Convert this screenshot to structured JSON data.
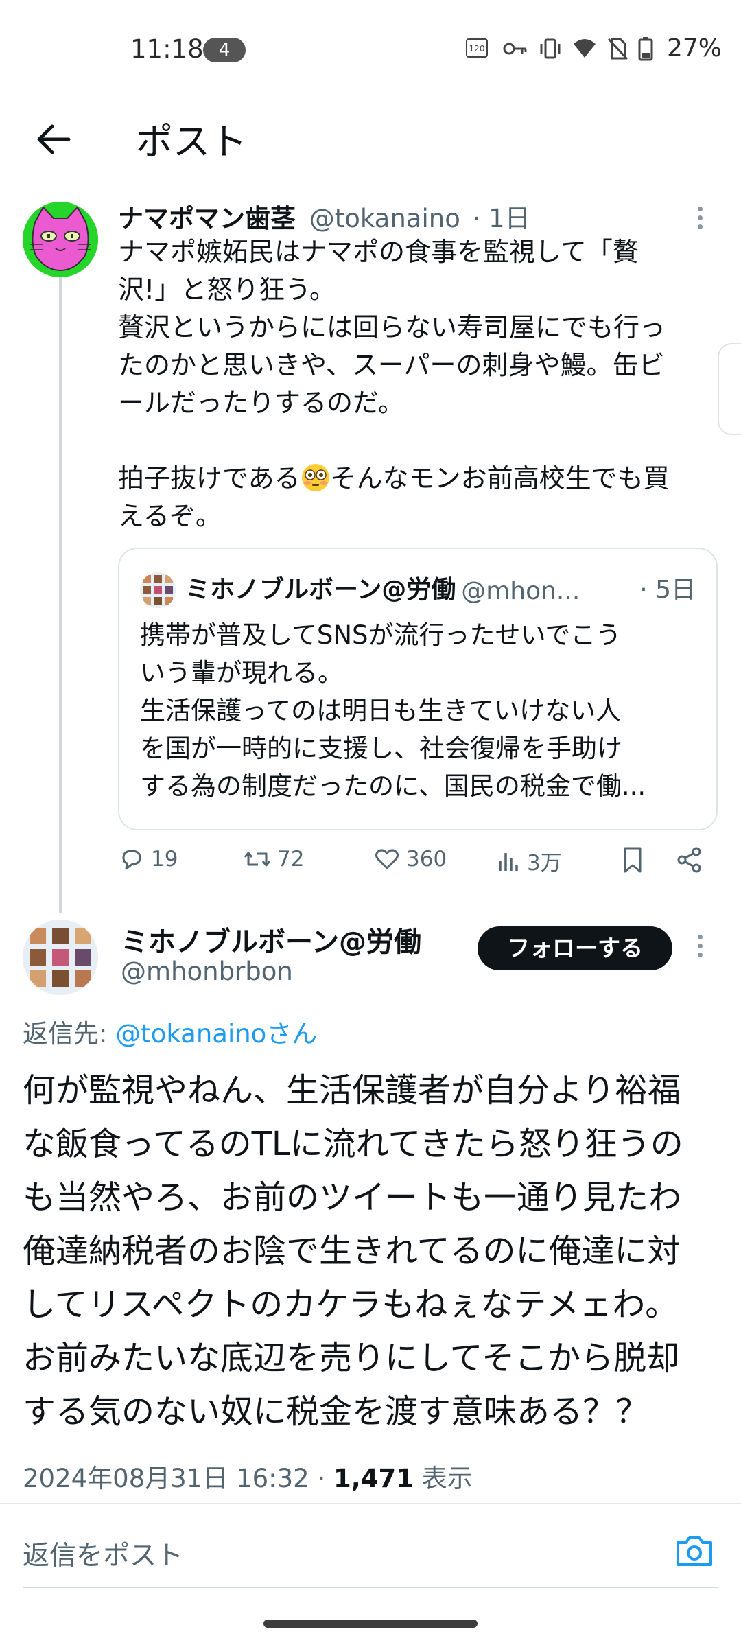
{
  "status_bar": {
    "time": "11:18",
    "notification_count": "4",
    "refresh_rate": "120",
    "battery": "27%"
  },
  "header": {
    "title": "ポスト"
  },
  "post1": {
    "author_name": "ナマポマン歯茎",
    "handle": "@tokanaino",
    "time": "· 1日",
    "text_before_emoji": "ナマポ嫉妬民はナマポの食事を監視して「贅\n沢!」と怒り狂う。\n贅沢というからには回らない寿司屋にでも行っ\nたのかと思いきや、スーパーの刺身や鰻。缶ビ\nールだったりするのだ。\n\n拍子抜けである",
    "emoji": "flushed-face-emoji",
    "text_after_emoji": "そんなモンお前高校生でも買\nえるぞ。",
    "quote": {
      "author_name": "ミホノブルボーン@労働",
      "handle": "@mhon...",
      "time": "· 5日",
      "lines": [
        "携帯が普及してSNSが流行ったせいでこう",
        "いう輩が現れる。",
        "生活保護ってのは明日も生きていけない人",
        "を国が一時的に支援し、社会復帰を手助け",
        "する為の制度だったのに、国民の税金で働..."
      ]
    },
    "actions": {
      "replies": "19",
      "reposts": "72",
      "likes": "360",
      "views": "3万"
    }
  },
  "post2": {
    "author_name": "ミホノブルボーン@労働",
    "handle": "@mhonbrbon",
    "follow_label": "フォローする",
    "reply_to_label": "返信先: ",
    "reply_to_link": "@tokanainoさん",
    "lines": [
      "何が監視やねん、生活保護者が自分より裕福",
      "な飯食ってるのTLに流れてきたら怒り狂うの",
      "も当然やろ、お前のツイートも一通り見たわ",
      "俺達納税者のお陰で生きれてるのに俺達に対",
      "してリスペクトのカケラもねぇなテメェわ。",
      "お前みたいな底辺を売りにしてそこから脱却",
      "する気のない奴に税金を渡す意味ある？？"
    ],
    "timestamp": "2024年08月31日 16:32 · ",
    "views_count": "1,471",
    "views_label": " 表示"
  },
  "reply_bar": {
    "placeholder": "返信をポスト"
  },
  "icons": {
    "back": "back-arrow-icon",
    "more": "more-vertical-icon",
    "reply": "reply-icon",
    "repost": "repost-icon",
    "like": "heart-icon",
    "views": "analytics-icon",
    "bookmark": "bookmark-icon",
    "share": "share-icon",
    "camera": "camera-icon"
  },
  "colors": {
    "link": "#1d9bf0",
    "secondary_text": "#536471",
    "follow_button": "#0f1419",
    "avatar1_bg": "#25d52a",
    "avatar1_cat": "#ec5ad2"
  }
}
